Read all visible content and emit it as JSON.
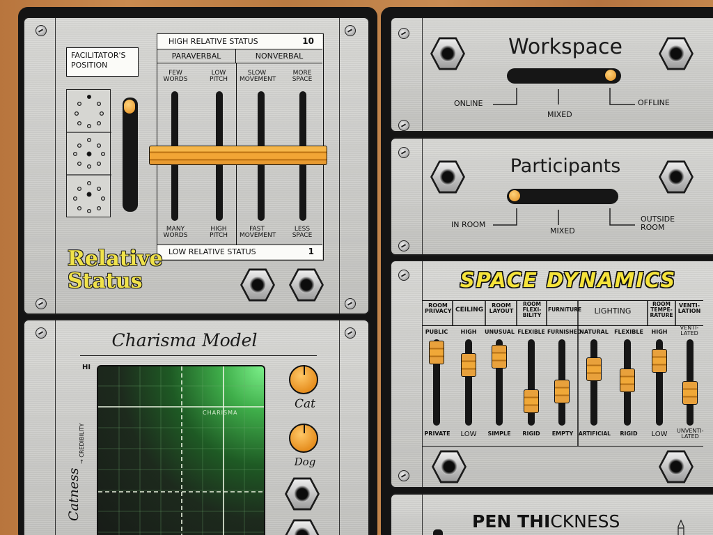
{
  "relative_status": {
    "facilitator_position": "FACILITATOR'S POSITION",
    "high_label": "HIGH RELATIVE STATUS",
    "high_value": "10",
    "low_label": "LOW RELATIVE STATUS",
    "low_value": "1",
    "groups": [
      "PARAVERBAL",
      "NONVERBAL"
    ],
    "top_labels": [
      "FEW WORDS",
      "LOW PITCH",
      "SLOW MOVEMENT",
      "MORE SPACE"
    ],
    "bottom_labels": [
      "MANY WORDS",
      "HIGH PITCH",
      "FAST MOVEMENT",
      "LESS SPACE"
    ],
    "title_line1": "Relative",
    "title_line2": "Status"
  },
  "charisma": {
    "title": "Charisma Model",
    "y_top": "HI",
    "y_axis": "CREDIBILITY",
    "x_axis": "Catness",
    "curve_label": "CHARISMA",
    "knob1": "Cat",
    "knob2": "Dog"
  },
  "workspace": {
    "title": "Workspace",
    "options": [
      "ONLINE",
      "MIXED",
      "OFFLINE"
    ],
    "position": "OFFLINE"
  },
  "participants": {
    "title": "Participants",
    "options": [
      "IN ROOM",
      "MIXED",
      "OUTSIDE ROOM"
    ],
    "position": "IN ROOM"
  },
  "space_dynamics": {
    "title": "SPACE DYNAMICS",
    "headers": [
      "ROOM PRIVACY",
      "CEILING",
      "ROOM LAYOUT",
      "ROOM FLEXI- BILITY",
      "FURNITURE",
      "LIGHTING",
      "ROOM TEMPE- RATURE",
      "VENTI- LATION"
    ],
    "top_labels": [
      "PUBLIC",
      "HIGH",
      "UNUSUAL",
      "FLEXIBLE",
      "FURNISHED",
      "NATURAL",
      "FLEXIBLE",
      "HIGH",
      "VENTI- LATED"
    ],
    "bottom_labels": [
      "PRIVATE",
      "LOW",
      "SIMPLE",
      "RIGID",
      "EMPTY",
      "ARTIFICIAL",
      "RIGID",
      "LOW",
      "UNVENTI- LATED"
    ]
  },
  "pen": {
    "title_a": "PEN ",
    "title_b": "THI",
    "title_c": "CKNESS"
  },
  "colors": {
    "accent": "#f0a838",
    "screen": "#2a2a2a",
    "title_yellow": "#f5e33a"
  }
}
